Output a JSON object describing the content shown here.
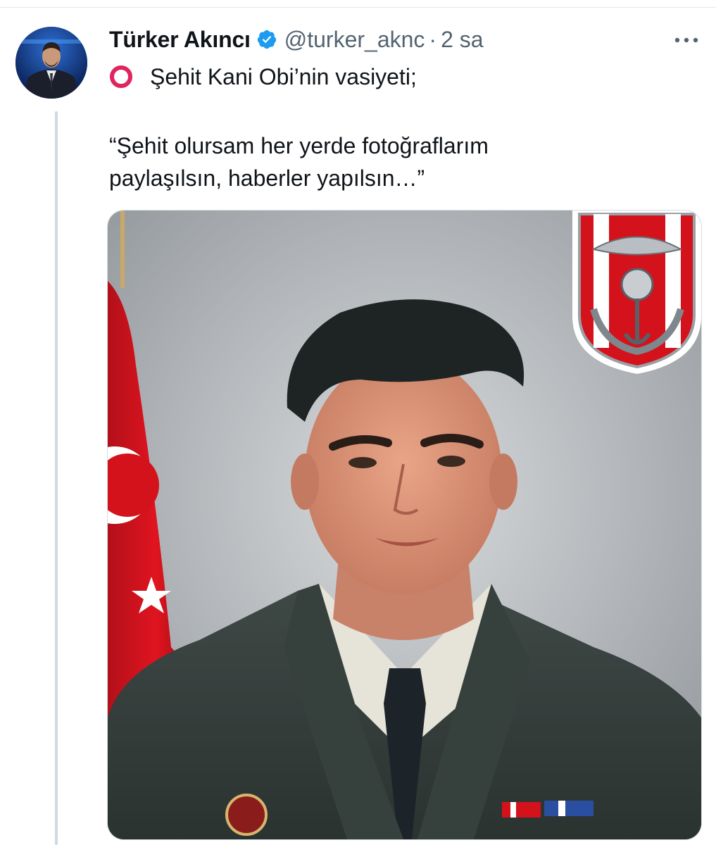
{
  "tweet": {
    "author_name": "Türker Akıncı",
    "handle": "@turker_aknc",
    "separator": "·",
    "time": "2 sa",
    "line1": "Şehit Kani Obi’nin vasiyeti;",
    "quote_line1": "“Şehit olursam her yerde fotoğraflarım",
    "quote_line2": "paylaşılsın, haberler yapılsın…”"
  },
  "icons": {
    "verified": "verified-badge-icon",
    "more": "more-options-icon",
    "circle": "red-hollow-circle-icon"
  },
  "colors": {
    "verified_blue": "#1d9bf0",
    "secondary_text": "#536471",
    "circle_red": "#e0245e",
    "thread_line": "#cfd9de"
  }
}
